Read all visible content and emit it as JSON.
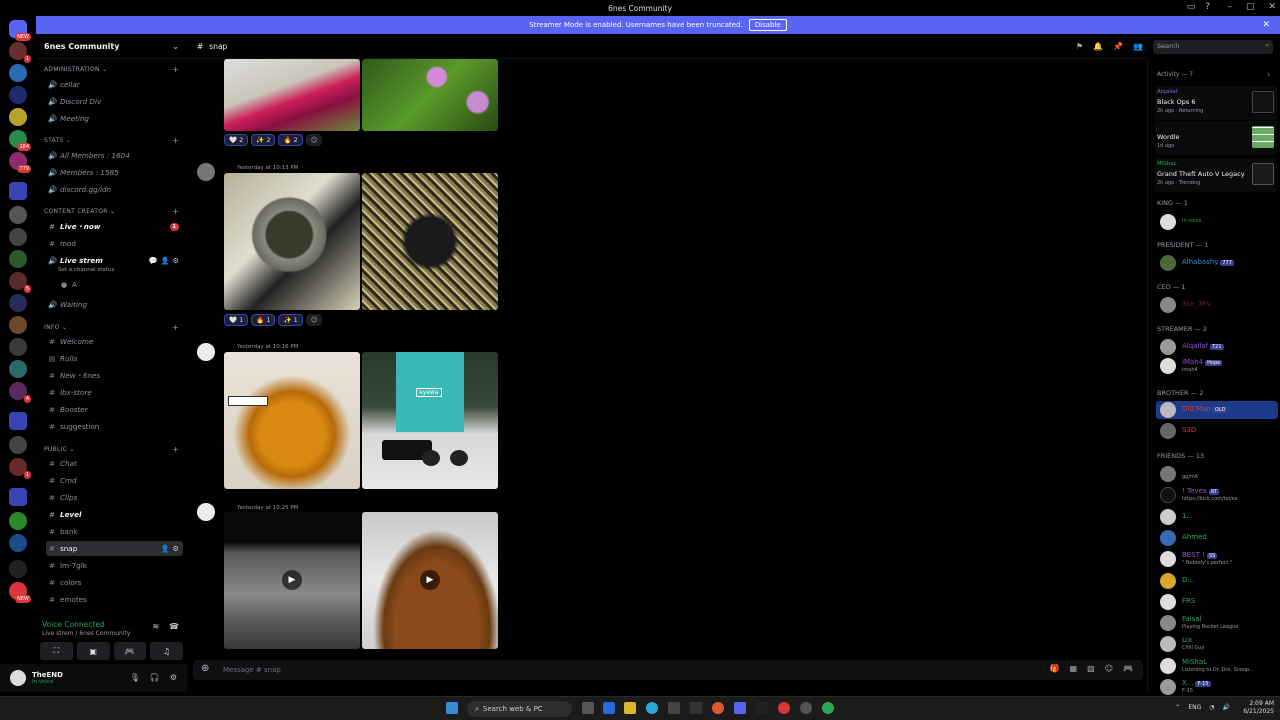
{
  "window": {
    "title": "6nes Community"
  },
  "banner": {
    "text": "Streamer Mode is enabled. Usernames have been truncated.",
    "button": "Disable"
  },
  "server_badges": [
    "NEW",
    "1",
    "284",
    "779",
    "5",
    "4",
    "1",
    "NEW"
  ],
  "server": {
    "name": "6nes Community"
  },
  "categories": {
    "admin": "ADMINISTRATION",
    "stats": "STATS",
    "creator": "CONTENT CREATOR",
    "info": "INFO",
    "public": "PUBLIC"
  },
  "channels": {
    "cellar": "cellar",
    "discord_div": "Discord Div",
    "meeting": "Meeting",
    "all_members": "All Members : 1604",
    "members": "Members : 1585",
    "discord_link": "discord.gg/idn",
    "live_now": "Live・now",
    "live_now_badge": "1",
    "mod": "mod",
    "live_strem": "Live strem",
    "live_strem_status": "Set a channel status",
    "voice_user": "A",
    "waiting": "Waiting",
    "welcome": "Welcome",
    "rules": "Rulls",
    "new_6nes": "New・6nes",
    "ibx_store": "ibx-store",
    "booster": "Booster",
    "suggestion": "suggestion",
    "chat": "Chat",
    "cmd": "Cmd",
    "clips": "Clips",
    "level": "Level",
    "bank": "bank",
    "snap": "snap",
    "lm_7glk": "lm-7glk",
    "colors": "colors",
    "emotes": "emotes"
  },
  "voice": {
    "status": "Voice Connected",
    "channel": "Live strem / 6nes Community"
  },
  "user": {
    "name": "TheEND",
    "status": "In voice"
  },
  "main": {
    "channel": "snap",
    "search_placeholder": "Search",
    "reactions1": [
      {
        "emoji": "🤍",
        "count": "2"
      },
      {
        "emoji": "✨",
        "count": "2"
      },
      {
        "emoji": "🔥",
        "count": "2"
      }
    ],
    "reactions2": [
      {
        "emoji": "🤍",
        "count": "1"
      },
      {
        "emoji": "🔥",
        "count": "1"
      },
      {
        "emoji": "✨",
        "count": "1"
      }
    ],
    "ts1": "Yesterday at 10:13 PM",
    "ts2": "Yesterday at 10:16 PM",
    "ts3": "Yesterday at 10:25 PM",
    "bag_label": "eyewa",
    "compose_placeholder": "Message #  snap"
  },
  "activity": {
    "header": "Activity — 7",
    "cards": [
      {
        "user": "Alqallaf",
        "game": "Black Ops 6",
        "sub": "2h ago · Returning"
      },
      {
        "user": "",
        "game": "Wordle",
        "sub": "1d ago"
      },
      {
        "user": "MiShaL",
        "game": "Grand Theft Auto V Legacy",
        "sub": "2h ago · Trending"
      }
    ]
  },
  "members": {
    "king": "KING — 1",
    "king_sub": "In voice",
    "president": "PRESIDENT — 1",
    "alhabashy": "Alhabashy",
    "alhabashy_tag": "777",
    "ceo": "CEO — 1",
    "ceo_name": "3sn_3hv",
    "streamer": "STREAMER — 2",
    "alqallaf": "Alqallaf",
    "alqallaf_tag": "T21",
    "imah4": "iMah4",
    "imah4_tag": "Hope",
    "imah4_sub": "imah4",
    "brother": "BROTHER — 2",
    "oldman": "Old Man",
    "oldman_tag": "OLD",
    "s3d": "S3D",
    "friends": "FRIENDS — 13",
    "f1_sub": "gg/m6",
    "tevex": "! Tevex",
    "tevex_tag": "RT",
    "tevex_sub": "https://kick.com/tevex",
    "f3": "1...",
    "ahmed": "Ahmed",
    "best": "BEST !",
    "best_tag": "SS",
    "best_sub": "\" Nobody's perfect \"",
    "d": "D...",
    "frs": "FRS",
    "faisal": "Faisal",
    "faisal_sub": "Playing Rocket League",
    "lix": "Lix",
    "lix_sub": "Chill Guy",
    "mishal": "MiShaL",
    "mishal_sub": "Listening to Dr. Dre, Snoop...",
    "x": "X...",
    "x_tag": "F-15",
    "x_sub": "F-15"
  },
  "taskbar": {
    "search": "Search web & PC",
    "lang": "ENG",
    "time": "2:09 AM",
    "date": "6/21/2025"
  },
  "colors": {
    "accent": "#5865f2",
    "online": "#23a55a",
    "badge": "#da373c"
  }
}
